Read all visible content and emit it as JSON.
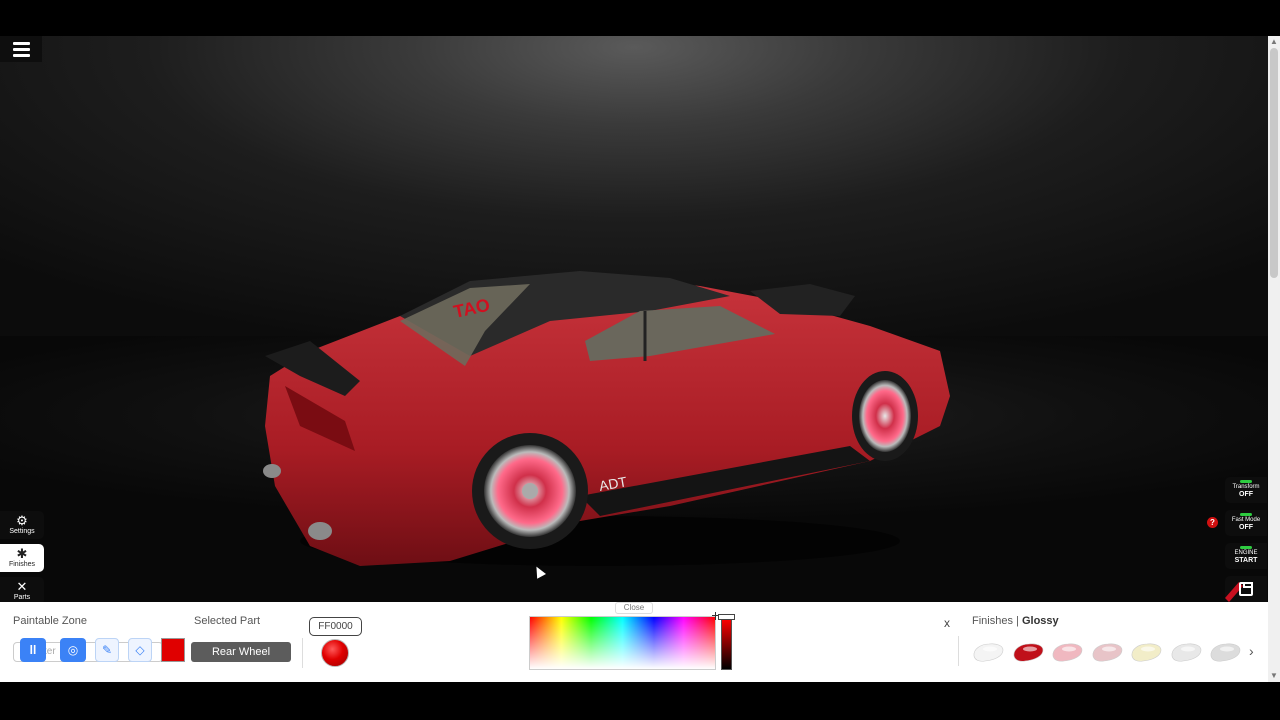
{
  "menu": {
    "icon": "hamburger-icon"
  },
  "left_toolbar": {
    "settings_label": "Settings",
    "finishes_label": "Finishes",
    "parts_label": "Parts"
  },
  "right_toolbar": {
    "transform": {
      "label": "Transform",
      "state": "OFF"
    },
    "fast_mode": {
      "label": "Fast Mode",
      "state": "OFF"
    },
    "engine": {
      "label": "ENGINE",
      "state": "START"
    },
    "help": "?",
    "led_color": "#2ecc40"
  },
  "car": {
    "body_color": "#b5202a",
    "windshield_text": "TAO",
    "side_text": "ADT"
  },
  "paint_panel": {
    "paintable_zone_label": "Paintable Zone",
    "zone_filter_placeholder": "ter",
    "selected_part_label": "Selected Part",
    "selected_part_value": "Rear Wheel",
    "hex_value": "FF0000",
    "swatch_color": "#e00000",
    "close_label": "Close"
  },
  "finishes": {
    "close": "x",
    "label": "Finishes",
    "current": "Glossy",
    "swatches": [
      {
        "name": "white-finish",
        "color": "#f4f4f4"
      },
      {
        "name": "red-finish",
        "color": "#c0101a"
      },
      {
        "name": "pink-finish",
        "color": "#f0b8c0"
      },
      {
        "name": "light-pink-finish",
        "color": "#e8c4c8"
      },
      {
        "name": "cream-finish",
        "color": "#f2edc8"
      },
      {
        "name": "silver-finish",
        "color": "#e8e8e8"
      },
      {
        "name": "grey-finish",
        "color": "#dcdcdc"
      }
    ],
    "next": "›"
  }
}
